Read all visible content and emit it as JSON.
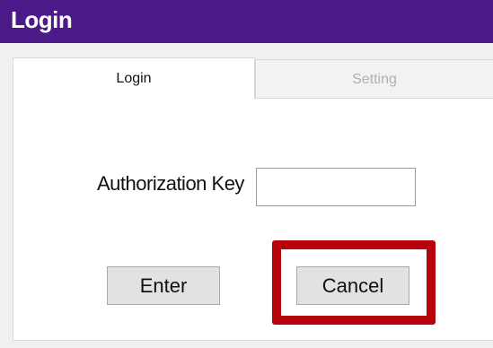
{
  "window": {
    "title": "Login",
    "titlebar_color": "#4b1a88"
  },
  "tabs": [
    {
      "label": "Login",
      "active": true
    },
    {
      "label": "Setting",
      "active": false
    }
  ],
  "form": {
    "auth_key_label": "Authorization Key",
    "auth_key_value": "",
    "enter_label": "Enter",
    "cancel_label": "Cancel"
  },
  "annotation": {
    "highlight_target": "Cancel",
    "highlight_color": "#b5040c"
  }
}
